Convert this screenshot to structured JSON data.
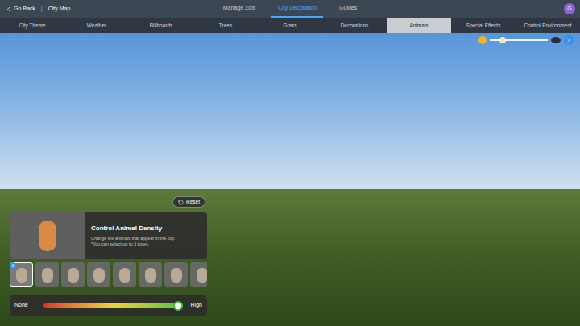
{
  "nav": {
    "back": "Go Back",
    "separator": "|",
    "location": "City Map"
  },
  "main_tabs": [
    {
      "label": "Manage Zols",
      "selected": false
    },
    {
      "label": "City Decoration",
      "selected": true
    },
    {
      "label": "Guides",
      "selected": false
    }
  ],
  "avatar": "G",
  "categories": [
    {
      "label": "City Theme",
      "selected": false
    },
    {
      "label": "Weather",
      "selected": false
    },
    {
      "label": "Billboards",
      "selected": false
    },
    {
      "label": "Trees",
      "selected": false
    },
    {
      "label": "Grass",
      "selected": false
    },
    {
      "label": "Decorations",
      "selected": false
    },
    {
      "label": "Animals",
      "selected": true
    },
    {
      "label": "Special Effects",
      "selected": false
    },
    {
      "label": "Control Environment",
      "selected": false
    }
  ],
  "time_slider": {
    "level": 0.22
  },
  "reset_button": "Reset",
  "panel": {
    "title": "Control Animal Density",
    "description": "Change the animals that appear in the city.",
    "note": "*You can select up to 3 types."
  },
  "animals": [
    {
      "selected": true,
      "badge": "1"
    },
    {
      "selected": false
    },
    {
      "selected": false
    },
    {
      "selected": false
    },
    {
      "selected": false
    },
    {
      "selected": false
    },
    {
      "selected": false
    },
    {
      "selected": false
    }
  ],
  "density": {
    "min_label": "None",
    "max_label": "High",
    "level": 0.97
  }
}
